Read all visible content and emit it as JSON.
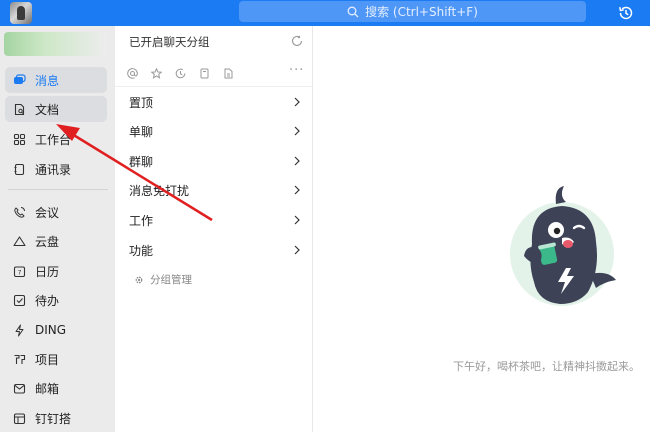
{
  "topbar": {
    "search_placeholder": "搜索 (Ctrl+Shift+F)",
    "accent_color": "#1a7bf3",
    "icons": [
      "app-logo",
      "search-icon",
      "history-icon"
    ]
  },
  "nav": {
    "items": [
      {
        "label": "消息",
        "icon": "message-icon",
        "state": "active"
      },
      {
        "label": "文档",
        "icon": "document-icon",
        "state": "hover"
      },
      {
        "label": "工作台",
        "icon": "workbench-icon",
        "state": "normal"
      },
      {
        "label": "通讯录",
        "icon": "contacts-icon",
        "state": "normal"
      },
      {
        "label": "会议",
        "icon": "meeting-icon",
        "state": "normal"
      },
      {
        "label": "云盘",
        "icon": "cloud-icon",
        "state": "normal"
      },
      {
        "label": "日历",
        "icon": "calendar-icon",
        "state": "normal"
      },
      {
        "label": "待办",
        "icon": "todo-icon",
        "state": "normal"
      },
      {
        "label": "DING",
        "icon": "ding-icon",
        "state": "normal"
      },
      {
        "label": "项目",
        "icon": "project-icon",
        "state": "normal"
      },
      {
        "label": "邮箱",
        "icon": "mail-icon",
        "state": "normal"
      },
      {
        "label": "钉钉搭",
        "icon": "dingda-icon",
        "state": "normal"
      }
    ]
  },
  "middle": {
    "title": "已开启聊天分组",
    "filter_icons": [
      "at-icon",
      "star-icon",
      "clock-icon",
      "bookmark-icon",
      "file-icon"
    ],
    "groups": [
      {
        "label": "置顶"
      },
      {
        "label": "单聊"
      },
      {
        "label": "群聊"
      },
      {
        "label": "消息免打扰"
      },
      {
        "label": "工作"
      },
      {
        "label": "功能"
      }
    ],
    "manage_label": "分组管理"
  },
  "main": {
    "greeting": "下午好，喝杯茶吧，让精神抖擞起来。",
    "mascot_circle_color": "#e3f3ea"
  }
}
